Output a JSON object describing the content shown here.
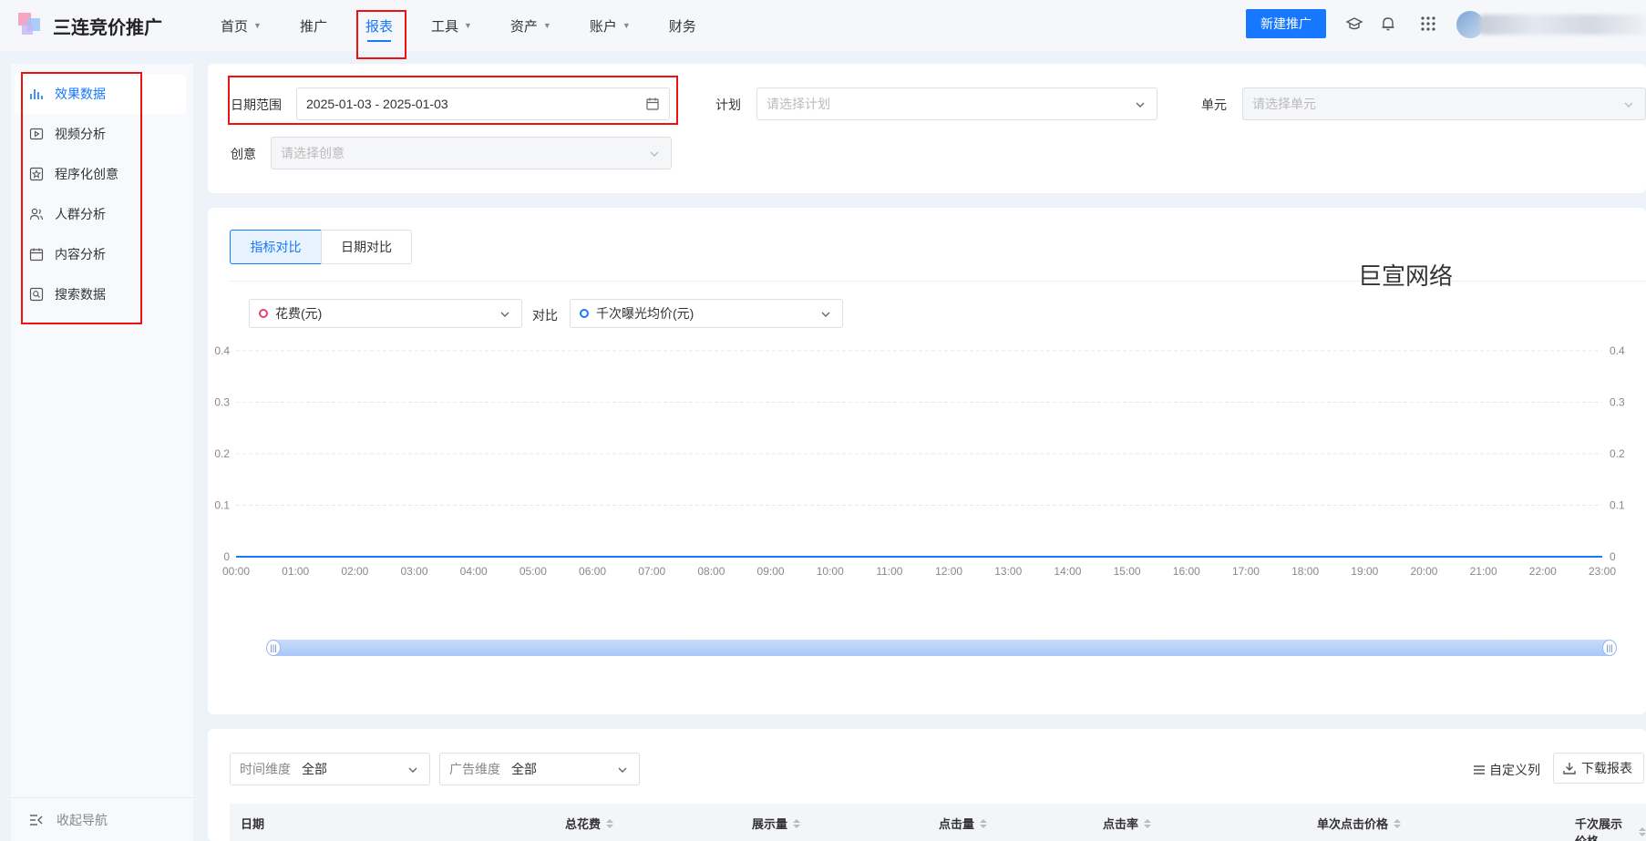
{
  "app": {
    "logo_text": "三连竞价推广"
  },
  "nav": [
    {
      "label": "首页",
      "has_caret": true
    },
    {
      "label": "推广",
      "has_caret": false
    },
    {
      "label": "报表",
      "has_caret": false,
      "active": true
    },
    {
      "label": "工具",
      "has_caret": true
    },
    {
      "label": "资产",
      "has_caret": true
    },
    {
      "label": "账户",
      "has_caret": true
    },
    {
      "label": "财务",
      "has_caret": false
    }
  ],
  "header": {
    "new_button": "新建推广",
    "icons": [
      "graduation-cap-icon",
      "bell-icon",
      "apps-grid-icon"
    ]
  },
  "sidebar": {
    "items": [
      {
        "label": "效果数据",
        "icon": "bar-chart-icon",
        "active": true
      },
      {
        "label": "视频分析",
        "icon": "video-icon"
      },
      {
        "label": "程序化创意",
        "icon": "star-box-icon"
      },
      {
        "label": "人群分析",
        "icon": "users-icon"
      },
      {
        "label": "内容分析",
        "icon": "calendar-icon"
      },
      {
        "label": "搜索数据",
        "icon": "search-box-icon"
      }
    ],
    "collapse_label": "收起导航"
  },
  "filters": {
    "date_label": "日期范围",
    "date_value": "2025-01-03 - 2025-01-03",
    "plan_label": "计划",
    "plan_placeholder": "请选择计划",
    "unit_label": "单元",
    "unit_placeholder": "请选择单元",
    "creative_label": "创意",
    "creative_placeholder": "请选择创意"
  },
  "chart_panel": {
    "tabs": [
      {
        "label": "指标对比",
        "active": true
      },
      {
        "label": "日期对比",
        "active": false
      }
    ],
    "watermark": "巨宣网络",
    "metric_left": "花费(元)",
    "compare_label": "对比",
    "metric_right": "千次曝光均价(元)",
    "colors": {
      "left": "#e8436f",
      "right": "#1677ff"
    }
  },
  "chart_data": {
    "type": "line",
    "x": [
      "00:00",
      "01:00",
      "02:00",
      "03:00",
      "04:00",
      "05:00",
      "06:00",
      "07:00",
      "08:00",
      "09:00",
      "10:00",
      "11:00",
      "12:00",
      "13:00",
      "14:00",
      "15:00",
      "16:00",
      "17:00",
      "18:00",
      "19:00",
      "20:00",
      "21:00",
      "22:00",
      "23:00"
    ],
    "series": [
      {
        "name": "花费(元)",
        "axis": "left",
        "values": [
          0,
          0,
          0,
          0,
          0,
          0,
          0,
          0,
          0,
          0,
          0,
          0,
          0,
          0,
          0,
          0,
          0,
          0,
          0,
          0,
          0,
          0,
          0,
          0
        ]
      },
      {
        "name": "千次曝光均价(元)",
        "axis": "right",
        "values": [
          0,
          0,
          0,
          0,
          0,
          0,
          0,
          0,
          0,
          0,
          0,
          0,
          0,
          0,
          0,
          0,
          0,
          0,
          0,
          0,
          0,
          0,
          0,
          0
        ]
      }
    ],
    "yticks_left": [
      "0.4",
      "0.3",
      "0.2",
      "0.1",
      "0"
    ],
    "yticks_right": [
      "0.4",
      "0.3",
      "0.2",
      "0.1",
      "0"
    ],
    "ylim": [
      0,
      0.4
    ],
    "grid": true,
    "line_color": "#1677ff"
  },
  "table_panel": {
    "time_dim_label": "时间维度",
    "time_dim_value": "全部",
    "ad_dim_label": "广告维度",
    "ad_dim_value": "全部",
    "custom_columns": "自定义列",
    "download": "下载报表",
    "columns": [
      "日期",
      "总花费",
      "展示量",
      "点击量",
      "点击率",
      "单次点击价格",
      "千次展示价格"
    ]
  }
}
